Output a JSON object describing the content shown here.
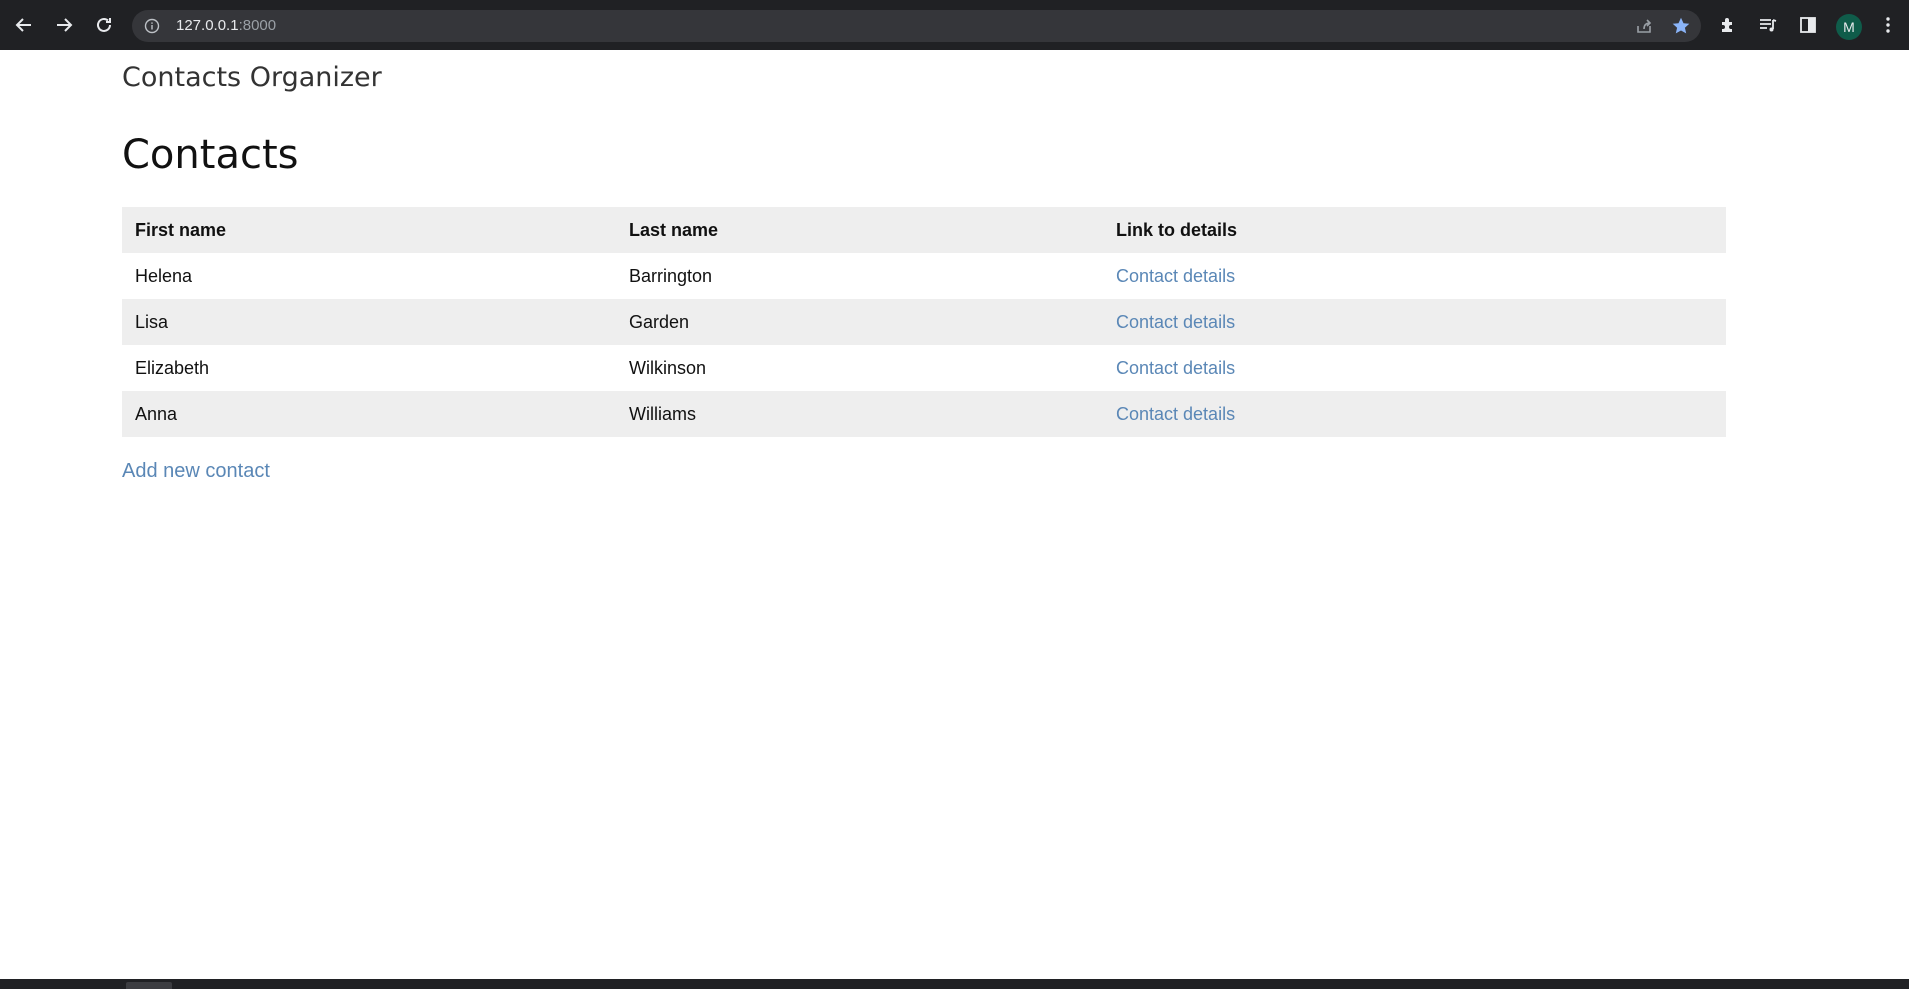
{
  "browser": {
    "url_host": "127.0.0.1",
    "url_port": ":8000",
    "profile_initial": "M",
    "icons": [
      "back-icon",
      "forward-icon",
      "reload-icon",
      "info-icon",
      "share-icon",
      "star-icon",
      "extensions-icon",
      "media-icon",
      "side-panel-icon",
      "menu-icon"
    ],
    "colors": {
      "toolbar": "#202124",
      "omnibox": "#35363a",
      "star": "#8ab4f8",
      "avatar": "#0f5c4a"
    }
  },
  "header": {
    "brand": "Contacts Organizer"
  },
  "main": {
    "title": "Contacts",
    "table": {
      "columns": [
        "First name",
        "Last name",
        "Link to details"
      ],
      "rows": [
        {
          "first_name": "Helena",
          "last_name": "Barrington",
          "link": "Contact details"
        },
        {
          "first_name": "Lisa",
          "last_name": "Garden",
          "link": "Contact details"
        },
        {
          "first_name": "Elizabeth",
          "last_name": "Wilkinson",
          "link": "Contact details"
        },
        {
          "first_name": "Anna",
          "last_name": "Williams",
          "link": "Contact details"
        }
      ]
    },
    "add_link": "Add new contact",
    "colors": {
      "link": "#5a87b6",
      "stripe": "#eeeeee"
    }
  }
}
